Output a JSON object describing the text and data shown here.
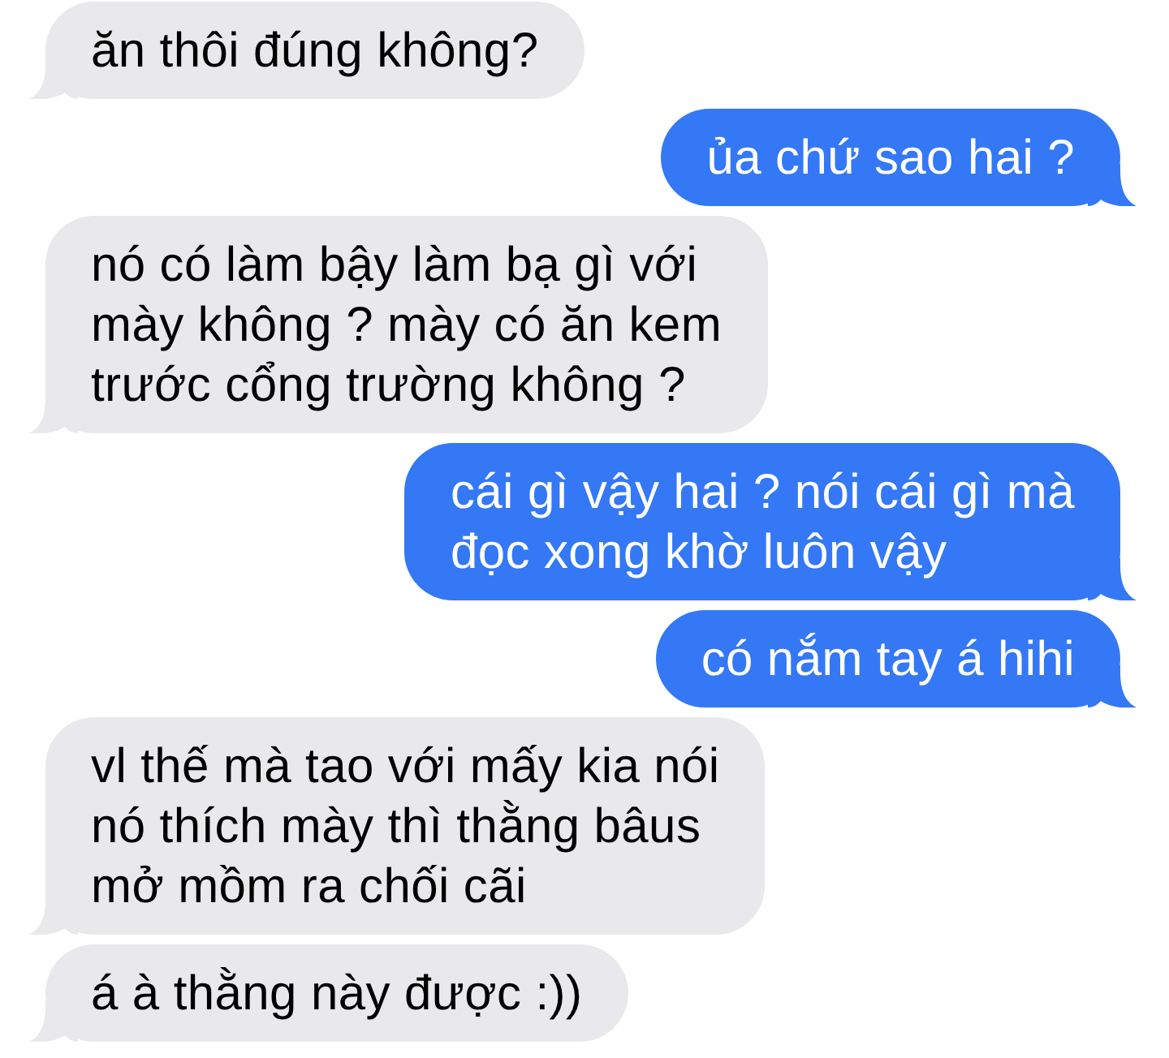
{
  "messages": [
    {
      "kind": "received",
      "text": "ăn thôi đúng không?"
    },
    {
      "kind": "sent",
      "text": "ủa chứ sao hai ?"
    },
    {
      "kind": "received",
      "text": "nó có làm bậy làm bạ gì với\nmày không ? mày có ăn kem\ntrước cổng trường không ?"
    },
    {
      "kind": "sent",
      "text": "cái gì vậy hai ? nói cái gì mà\nđọc xong khờ luôn vậy"
    },
    {
      "kind": "sent",
      "text": "có nắm tay á hihi"
    },
    {
      "kind": "received",
      "text": "vl thế mà tao với mấy kia nói\nnó thích mày thì thằng bâus\nmở mồm ra chối cãi"
    },
    {
      "kind": "received",
      "text": "á à thằng này được :))"
    }
  ]
}
